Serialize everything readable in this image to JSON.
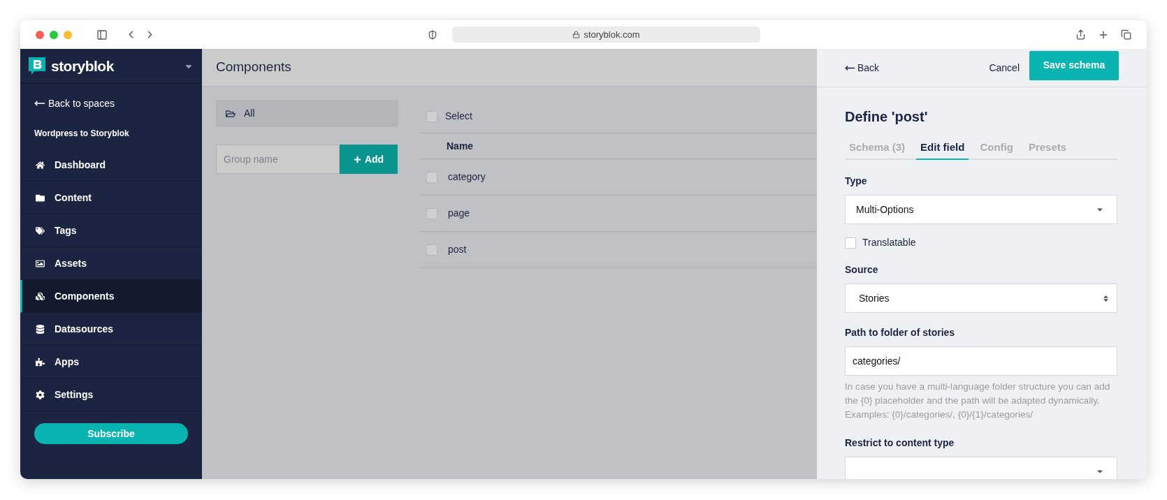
{
  "browser": {
    "url": "storyblok.com"
  },
  "sidebar": {
    "brand": "storyblok",
    "back_link": "Back to spaces",
    "space_name": "Wordpress to Storyblok",
    "items": [
      {
        "label": "Dashboard",
        "selected": false
      },
      {
        "label": "Content",
        "selected": false
      },
      {
        "label": "Tags",
        "selected": false
      },
      {
        "label": "Assets",
        "selected": false
      },
      {
        "label": "Components",
        "selected": true
      },
      {
        "label": "Datasources",
        "selected": false
      },
      {
        "label": "Apps",
        "selected": false
      },
      {
        "label": "Settings",
        "selected": false
      }
    ],
    "subscribe": "Subscribe"
  },
  "main": {
    "title": "Components",
    "groups": [
      {
        "label": "All",
        "selected": true
      }
    ],
    "group_input": {
      "placeholder": "Group name"
    },
    "add_button": "Add",
    "select_all": {
      "label": "Select",
      "checked": false
    },
    "table": {
      "columns": [
        "Name"
      ],
      "rows": [
        {
          "name": "category",
          "checked": false
        },
        {
          "name": "page",
          "checked": false
        },
        {
          "name": "post",
          "checked": false
        }
      ]
    }
  },
  "panel": {
    "back": "Back",
    "cancel": "Cancel",
    "save": "Save schema",
    "title": "Define 'post'",
    "tabs": [
      {
        "label": "Schema (3)",
        "selected": false
      },
      {
        "label": "Edit field",
        "selected": true
      },
      {
        "label": "Config",
        "selected": false
      },
      {
        "label": "Presets",
        "selected": false
      }
    ],
    "fields": [
      {
        "kind": "select",
        "label": "Type",
        "value": "Multi-Options"
      },
      {
        "kind": "checkbox",
        "label": "Translatable",
        "checked": false
      },
      {
        "kind": "stepper",
        "label": "Source",
        "value": "Stories"
      },
      {
        "kind": "input",
        "label": "Path to folder of stories",
        "value": "categories/",
        "hint": "In case you have a multi-language folder structure you can add the {0} placeholder and the path will be adapted dynamically. Examples: {0}/categories/, {0}/{1}/categories/"
      },
      {
        "kind": "select",
        "label": "Restrict to content type"
      }
    ]
  }
}
